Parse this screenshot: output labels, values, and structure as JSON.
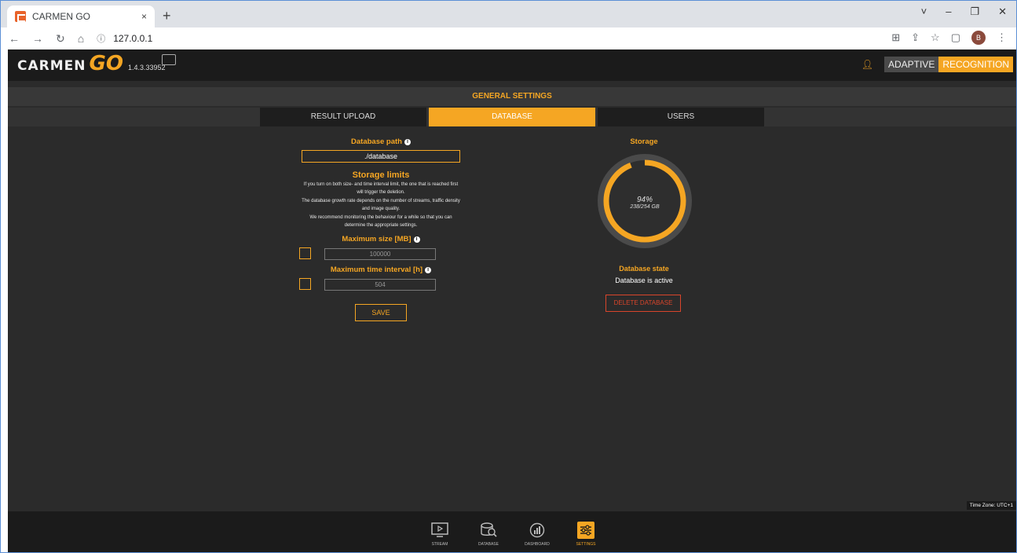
{
  "browser": {
    "tab_title": "CARMEN GO",
    "tab_close": "×",
    "new_tab": "+",
    "url": "127.0.0.1",
    "avatar_letter": "B",
    "window_controls": [
      "˅",
      "–",
      "❐",
      "✕"
    ]
  },
  "header": {
    "logo_text": "CARMEN",
    "logo_go": "GO",
    "version": "1.4.3.33952",
    "brand_part1": "ADAPTIVE",
    "brand_part2": "RECOGNITION"
  },
  "page": {
    "title": "GENERAL SETTINGS"
  },
  "settings_tabs": [
    {
      "label": "RESULT UPLOAD",
      "active": false
    },
    {
      "label": "DATABASE",
      "active": true
    },
    {
      "label": "USERS",
      "active": false
    }
  ],
  "database": {
    "path_label": "Database path",
    "path_value": "./database",
    "storage_limits_title": "Storage limits",
    "note1": "If you turn on both size- and time interval limit, the one that is reached first will trigger the deletion.",
    "note2": "The database growth rate depends on the number of streams, traffic density and image quality.",
    "note3": "We recommend monitoring the behaviour for a while so that you can determine the appropriate settings.",
    "max_size_label": "Maximum size [MB]",
    "max_size_value": "100000",
    "max_time_label": "Maximum time interval [h]",
    "max_time_value": "504",
    "save_label": "SAVE"
  },
  "storage": {
    "title": "Storage",
    "percent_text": "94%",
    "usage_text": "238/254 GB",
    "fill_fraction": 0.94,
    "state_title": "Database state",
    "state_value": "Database is active",
    "delete_label": "DELETE DATABASE"
  },
  "timezone": "Time Zone: UTC+1",
  "bottom_nav": [
    {
      "label": "STREAM",
      "icon": "play-screen-icon",
      "active": false
    },
    {
      "label": "DATABASE",
      "icon": "database-search-icon",
      "active": false
    },
    {
      "label": "DASHBOARD",
      "icon": "dashboard-chart-icon",
      "active": false
    },
    {
      "label": "SETTINGS",
      "icon": "sliders-icon",
      "active": true
    }
  ],
  "colors": {
    "accent": "#f5a623",
    "danger": "#d9452b",
    "background": "#2b2b2b",
    "bar": "#1b1b1b"
  }
}
